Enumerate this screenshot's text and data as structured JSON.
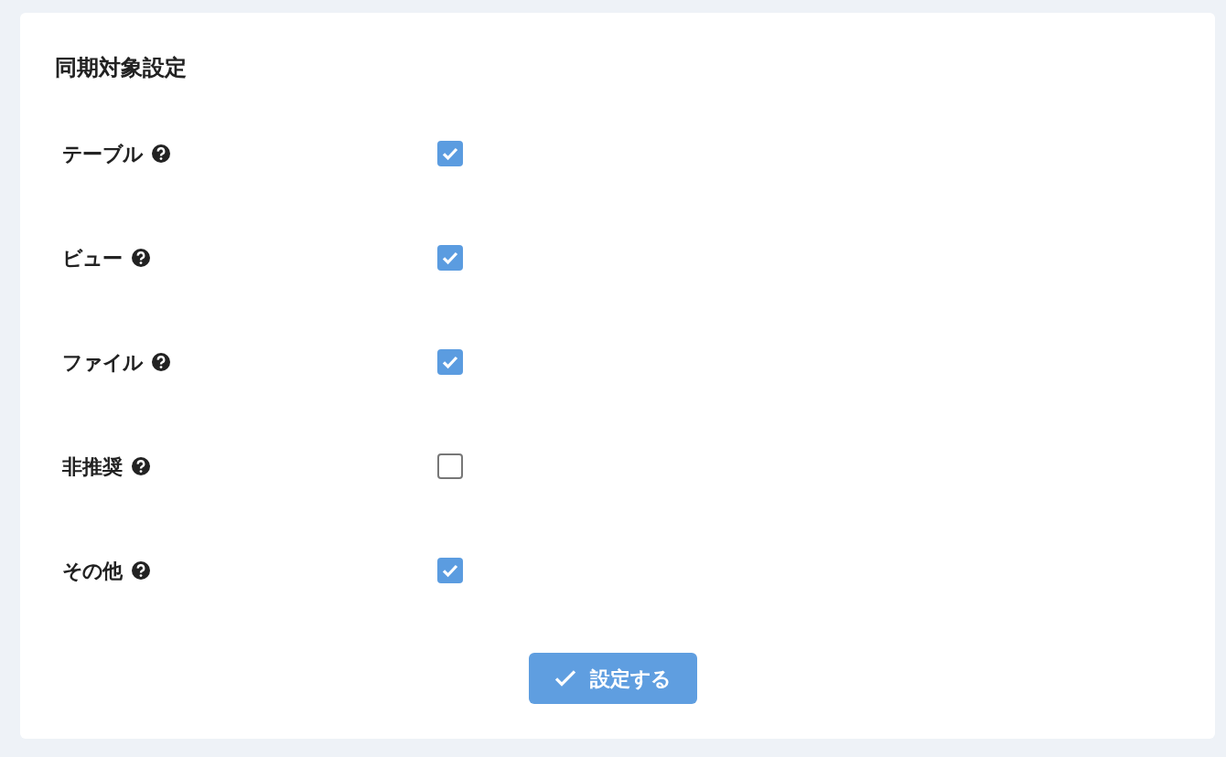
{
  "title": "同期対象設定",
  "options": [
    {
      "label": "テーブル",
      "checked": true
    },
    {
      "label": "ビュー",
      "checked": true
    },
    {
      "label": "ファイル",
      "checked": true
    },
    {
      "label": "非推奨",
      "checked": false
    },
    {
      "label": "その他",
      "checked": true
    }
  ],
  "submit_button": {
    "label": "設定する"
  }
}
